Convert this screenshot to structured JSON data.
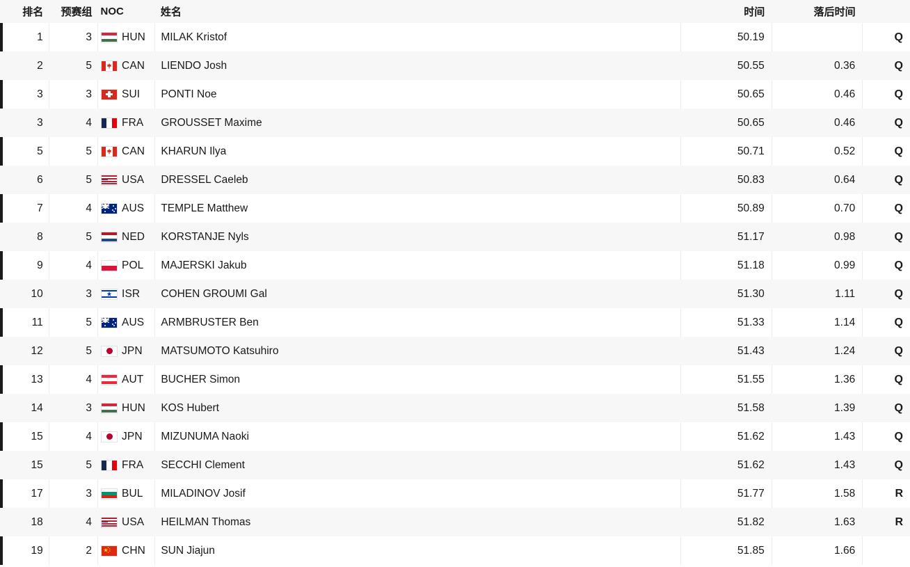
{
  "table": {
    "headers": {
      "rank": "排名",
      "heat": "预赛组",
      "noc": "NOC",
      "name": "姓名",
      "time": "时间",
      "gap": "落后时间",
      "mark": ""
    },
    "colors": {
      "header_bg": "#f7f7f7",
      "row_odd_bg": "#ffffff",
      "row_even_bg": "#f7f7f7",
      "accent_bar": "#1a1a1a",
      "text": "#19191a",
      "divider": "#ececec"
    },
    "rows": [
      {
        "rank": "1",
        "heat": "3",
        "noc": "HUN",
        "name": "MILAK Kristof",
        "time": "50.19",
        "gap": "",
        "mark": "Q"
      },
      {
        "rank": "2",
        "heat": "5",
        "noc": "CAN",
        "name": "LIENDO Josh",
        "time": "50.55",
        "gap": "0.36",
        "mark": "Q"
      },
      {
        "rank": "3",
        "heat": "3",
        "noc": "SUI",
        "name": "PONTI Noe",
        "time": "50.65",
        "gap": "0.46",
        "mark": "Q"
      },
      {
        "rank": "3",
        "heat": "4",
        "noc": "FRA",
        "name": "GROUSSET Maxime",
        "time": "50.65",
        "gap": "0.46",
        "mark": "Q"
      },
      {
        "rank": "5",
        "heat": "5",
        "noc": "CAN",
        "name": "KHARUN Ilya",
        "time": "50.71",
        "gap": "0.52",
        "mark": "Q"
      },
      {
        "rank": "6",
        "heat": "5",
        "noc": "USA",
        "name": "DRESSEL Caeleb",
        "time": "50.83",
        "gap": "0.64",
        "mark": "Q"
      },
      {
        "rank": "7",
        "heat": "4",
        "noc": "AUS",
        "name": "TEMPLE Matthew",
        "time": "50.89",
        "gap": "0.70",
        "mark": "Q"
      },
      {
        "rank": "8",
        "heat": "5",
        "noc": "NED",
        "name": "KORSTANJE Nyls",
        "time": "51.17",
        "gap": "0.98",
        "mark": "Q"
      },
      {
        "rank": "9",
        "heat": "4",
        "noc": "POL",
        "name": "MAJERSKI Jakub",
        "time": "51.18",
        "gap": "0.99",
        "mark": "Q"
      },
      {
        "rank": "10",
        "heat": "3",
        "noc": "ISR",
        "name": "COHEN GROUMI Gal",
        "time": "51.30",
        "gap": "1.11",
        "mark": "Q"
      },
      {
        "rank": "11",
        "heat": "5",
        "noc": "AUS",
        "name": "ARMBRUSTER Ben",
        "time": "51.33",
        "gap": "1.14",
        "mark": "Q"
      },
      {
        "rank": "12",
        "heat": "5",
        "noc": "JPN",
        "name": "MATSUMOTO Katsuhiro",
        "time": "51.43",
        "gap": "1.24",
        "mark": "Q"
      },
      {
        "rank": "13",
        "heat": "4",
        "noc": "AUT",
        "name": "BUCHER Simon",
        "time": "51.55",
        "gap": "1.36",
        "mark": "Q"
      },
      {
        "rank": "14",
        "heat": "3",
        "noc": "HUN",
        "name": "KOS Hubert",
        "time": "51.58",
        "gap": "1.39",
        "mark": "Q"
      },
      {
        "rank": "15",
        "heat": "4",
        "noc": "JPN",
        "name": "MIZUNUMA Naoki",
        "time": "51.62",
        "gap": "1.43",
        "mark": "Q"
      },
      {
        "rank": "15",
        "heat": "5",
        "noc": "FRA",
        "name": "SECCHI Clement",
        "time": "51.62",
        "gap": "1.43",
        "mark": "Q"
      },
      {
        "rank": "17",
        "heat": "3",
        "noc": "BUL",
        "name": "MILADINOV Josif",
        "time": "51.77",
        "gap": "1.58",
        "mark": "R"
      },
      {
        "rank": "18",
        "heat": "4",
        "noc": "USA",
        "name": "HEILMAN Thomas",
        "time": "51.82",
        "gap": "1.63",
        "mark": "R"
      },
      {
        "rank": "19",
        "heat": "2",
        "noc": "CHN",
        "name": "SUN Jiajun",
        "time": "51.85",
        "gap": "1.66",
        "mark": ""
      }
    ]
  }
}
